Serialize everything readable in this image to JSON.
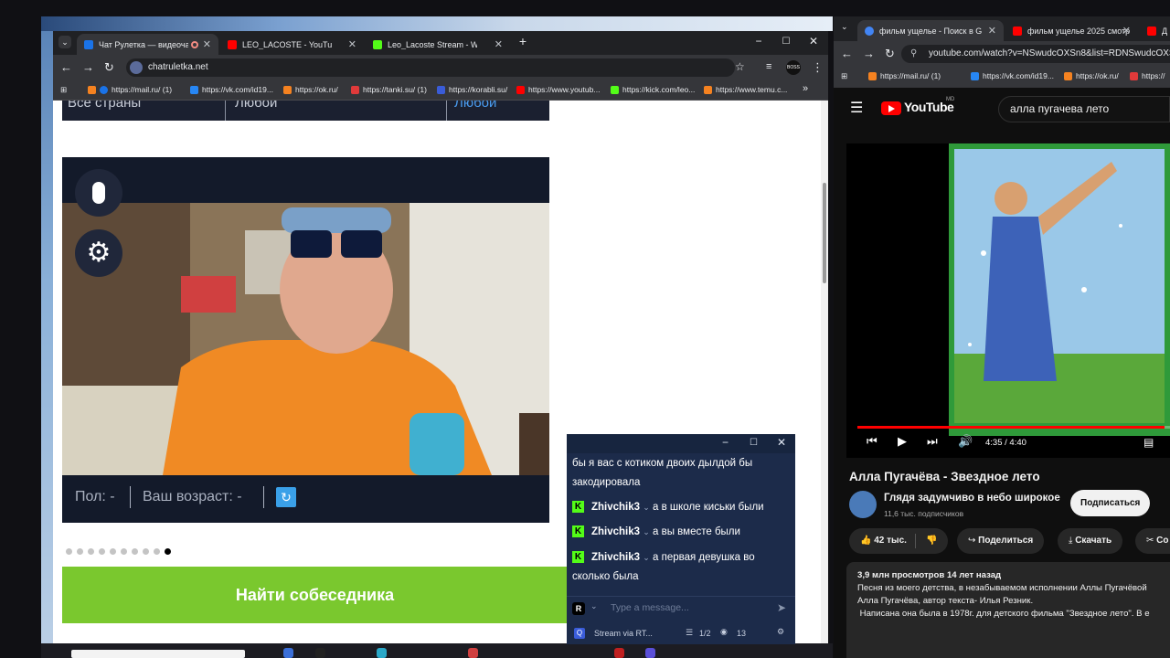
{
  "left_browser": {
    "tabs": [
      {
        "label": "Чат Рулетка — видеочат с",
        "favicon_color": "#1a73e8"
      },
      {
        "label": "LEO_LACOSTE - YouTube",
        "favicon_color": "#ff0000"
      },
      {
        "label": "Leo_Lacoste Stream - Watch Li",
        "favicon_color": "#53fc18"
      }
    ],
    "url": "chatruletka.net",
    "profile_label": "BOSS",
    "bookmarks": [
      "https://mail.ru/ (1)",
      "https://vk.com/id19...",
      "https://ok.ru/",
      "https://tanki.su/ (1)",
      "https://korabli.su/",
      "https://www.youtub...",
      "https://kick.com/leo...",
      "https://www.temu.c..."
    ]
  },
  "chatruletka": {
    "filter": {
      "country": "Все страны",
      "gender": "Любой",
      "extra": "Любой"
    },
    "gender_label": "Пол: -",
    "age_label": "Ваш возраст: -",
    "find_button": "Найти собеседника",
    "dots_count": 10
  },
  "chat_overlay": {
    "messages": [
      {
        "user": "",
        "text": "бы я вас с котиком двоих дылдой бы закодировала"
      },
      {
        "user": "Zhivchik3",
        "text": "а в школе киськи были"
      },
      {
        "user": "Zhivchik3",
        "text": "а вы вместе были"
      },
      {
        "user": "Zhivchik3",
        "text": "а первая девушка во сколько была"
      }
    ],
    "input_placeholder": "Type a message...",
    "input_avatar": "R",
    "footer_label": "Stream via RT...",
    "footer_pages": "1/2",
    "footer_viewers": "13"
  },
  "right_browser": {
    "tabs": [
      {
        "label": "фильм ущелье - Поиск в Goog",
        "favicon_color": "#4285f4"
      },
      {
        "label": "фильм ущелье 2025 смотреть",
        "favicon_color": "#ff0000"
      },
      {
        "label": "Д",
        "favicon_color": "#ff0000"
      }
    ],
    "url": "youtube.com/watch?v=NSwudcOXSn8&list=RDNSwudcOXSn8&",
    "bookmarks": [
      "https://mail.ru/ (1)",
      "https://vk.com/id19...",
      "https://ok.ru/",
      "https://"
    ],
    "youtube": {
      "logo": "YouTube",
      "region": "MD",
      "search_value": "алла пугачева лето",
      "time": "4:35 / 4:40",
      "progress": 0.982,
      "title": "Алла Пугачёва - Звездное лето",
      "channel": "Глядя задумчиво в небо широкое",
      "subscribers": "11,6 тыс. подписчиков",
      "subscribe": "Подписаться",
      "likes": "42 тыс.",
      "share": "Поделиться",
      "download": "Скачать",
      "clip_partial": "Co",
      "views_date": "3,9 млн просмотров  14 лет назад",
      "description": [
        "Песня  из моего детства, в незабываемом исполнении Аллы Пугачёвой",
        "Алла Пугачёва, автор текста- Илья Резник.",
        " Написана она была в 1978г. для детского фильма \"Звездное лето\". В е"
      ]
    }
  }
}
